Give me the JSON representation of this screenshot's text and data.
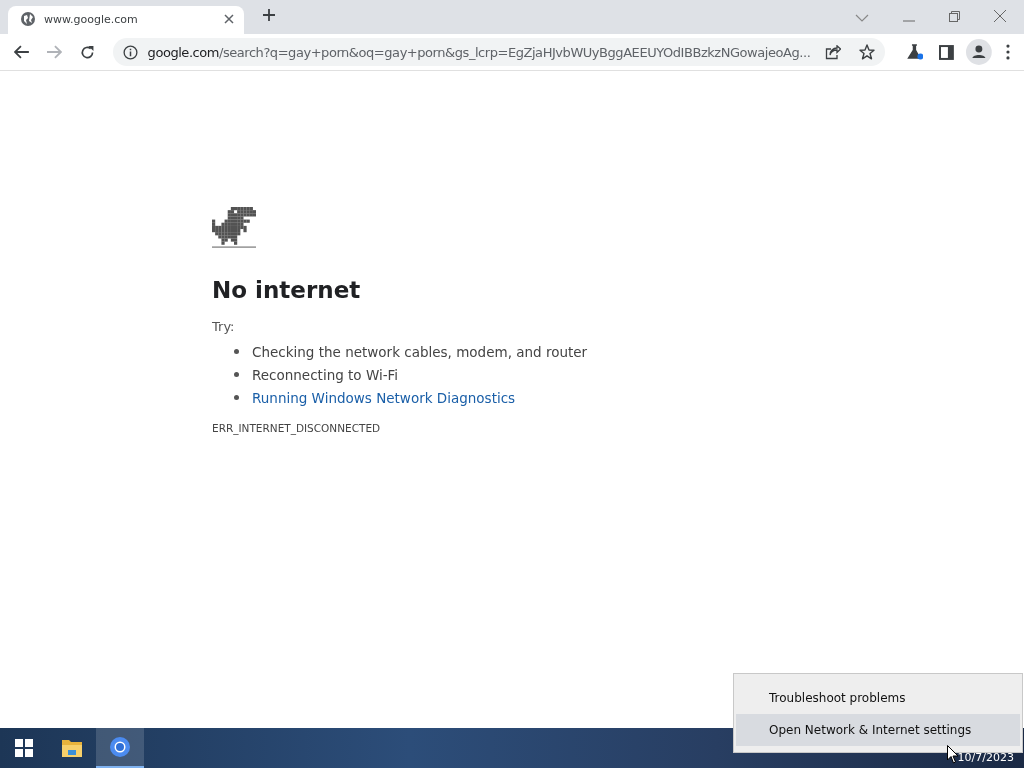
{
  "tab": {
    "title": "www.google.com",
    "selected": true
  },
  "address_bar": {
    "host": "google.com",
    "path": "/search?q=gay+porn&oq=gay+porn&gs_lcrp=EgZjaHJvbWUyBggAEEUYOdIBBzkzNGowajeoAg..."
  },
  "error_page": {
    "title": "No internet",
    "try_label": "Try:",
    "suggestions": [
      {
        "text": "Checking the network cables, modem, and router",
        "kind": "text"
      },
      {
        "text": "Reconnecting to Wi-Fi",
        "kind": "text"
      },
      {
        "text": "Running Windows Network Diagnostics",
        "kind": "link"
      }
    ],
    "error_code": "ERR_INTERNET_DISCONNECTED"
  },
  "context_menu": {
    "items": [
      {
        "label": "Troubleshoot problems",
        "selected": false
      },
      {
        "label": "Open Network & Internet settings",
        "selected": true
      }
    ]
  },
  "taskbar": {
    "apps": [
      {
        "kind": "start",
        "selected": false
      },
      {
        "kind": "folder",
        "selected": false
      },
      {
        "kind": "browser",
        "selected": true
      }
    ],
    "date": "10/7/2023"
  }
}
